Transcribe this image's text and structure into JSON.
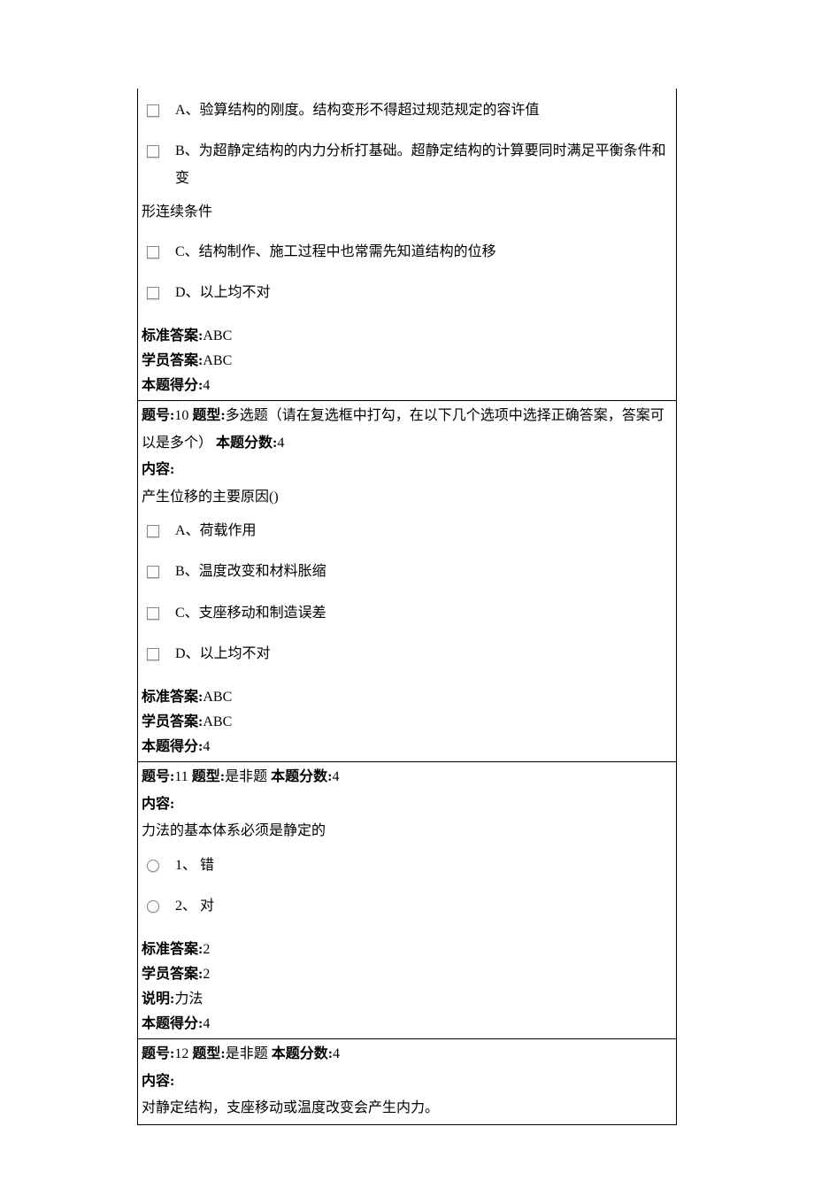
{
  "q9_partial": {
    "optA": "A、验算结构的刚度。结构变形不得超过规范规定的容许值",
    "optB_line1": "B、为超静定结构的内力分析打基础。超静定结构的计算要同时满足平衡条件和变",
    "optB_line2": "形连续条件",
    "optC": "C、结构制作、施工过程中也常需先知道结构的位移",
    "optD": "D、以上均不对",
    "stdLabel": "标准答案:",
    "stdVal": "ABC",
    "stuLabel": "学员答案:",
    "stuVal": "ABC",
    "scoreLabel": "本题得分:",
    "scoreVal": "4"
  },
  "q10": {
    "numLabel": "题号:",
    "numVal": "10",
    "typeLabel": " 题型:",
    "typeVal": "多选题（请在复选框中打勾，在以下几个选项中选择正确答案，答案可",
    "typeVal2": "以是多个）",
    "ptsLabel": " 本题分数:",
    "ptsVal": "4",
    "contentLabel": "内容:",
    "content": "产生位移的主要原因()",
    "optA": "A、荷载作用",
    "optB": "B、温度改变和材料胀缩",
    "optC": "C、支座移动和制造误差",
    "optD": "D、以上均不对",
    "stdLabel": "标准答案:",
    "stdVal": "ABC",
    "stuLabel": "学员答案:",
    "stuVal": "ABC",
    "scoreLabel": "本题得分:",
    "scoreVal": "4"
  },
  "q11": {
    "numLabel": "题号:",
    "numVal": "11",
    "typeLabel": " 题型:",
    "typeVal": "是非题",
    "ptsLabel": " 本题分数:",
    "ptsVal": "4",
    "contentLabel": "内容:",
    "content": "力法的基本体系必须是静定的",
    "opt1": "1、 错",
    "opt2": "2、 对",
    "stdLabel": "标准答案:",
    "stdVal": "2",
    "stuLabel": "学员答案:",
    "stuVal": "2",
    "noteLabel": "说明:",
    "noteVal": "力法",
    "scoreLabel": "本题得分:",
    "scoreVal": "4"
  },
  "q12": {
    "numLabel": "题号:",
    "numVal": "12",
    "typeLabel": " 题型:",
    "typeVal": "是非题",
    "ptsLabel": " 本题分数:",
    "ptsVal": "4",
    "contentLabel": "内容:",
    "content": "对静定结构，支座移动或温度改变会产生内力。"
  }
}
